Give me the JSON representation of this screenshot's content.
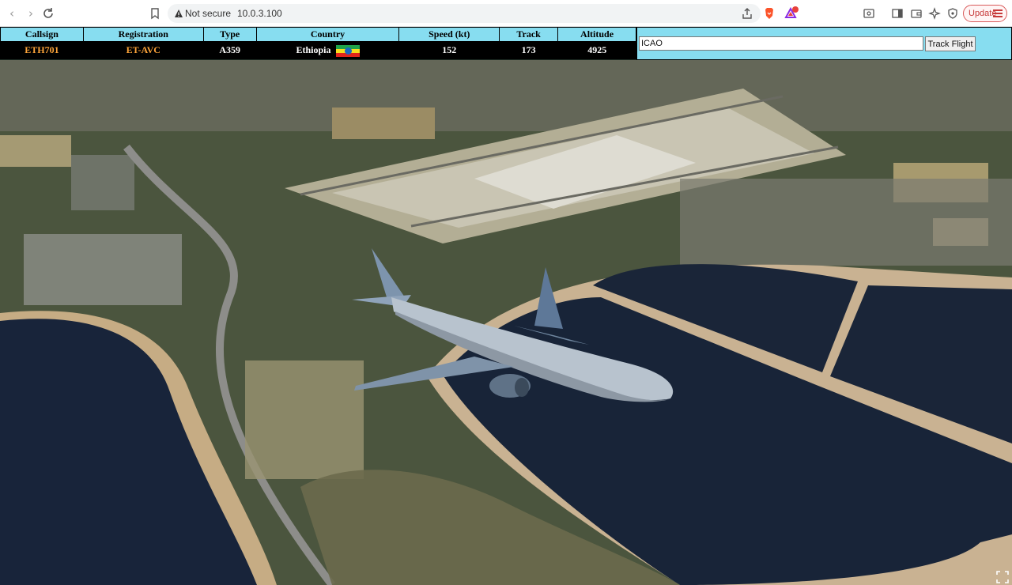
{
  "browser": {
    "security_label": "Not secure",
    "url": "10.0.3.100",
    "update_label": "Update",
    "notification_count": "1"
  },
  "flight": {
    "headers": {
      "callsign": "Callsign",
      "registration": "Registration",
      "type": "Type",
      "country": "Country",
      "speed": "Speed (kt)",
      "track": "Track",
      "altitude": "Altitude"
    },
    "values": {
      "callsign": "ETH701",
      "registration": "ET-AVC",
      "type": "A359",
      "country": "Ethiopia",
      "speed": "152",
      "track": "173",
      "altitude": "4925"
    }
  },
  "tracker": {
    "input_placeholder": "ICAO",
    "input_value": "ICAO",
    "button_label": "Track Flight"
  },
  "colors": {
    "header_bg": "#87ddf0",
    "row_bg": "#000000",
    "accent_orange": "#ffa53a"
  },
  "icons": [
    "back-icon",
    "forward-icon",
    "reload-icon",
    "bookmark-icon",
    "warning-icon",
    "share-icon",
    "brave-lion-icon",
    "rewards-triangle-icon",
    "screenshot-icon",
    "sidebar-icon",
    "wallet-icon",
    "leo-ai-icon",
    "vpn-shield-icon",
    "menu-icon",
    "ethiopia-flag-icon",
    "aircraft-3d-model",
    "fullscreen-icon"
  ]
}
